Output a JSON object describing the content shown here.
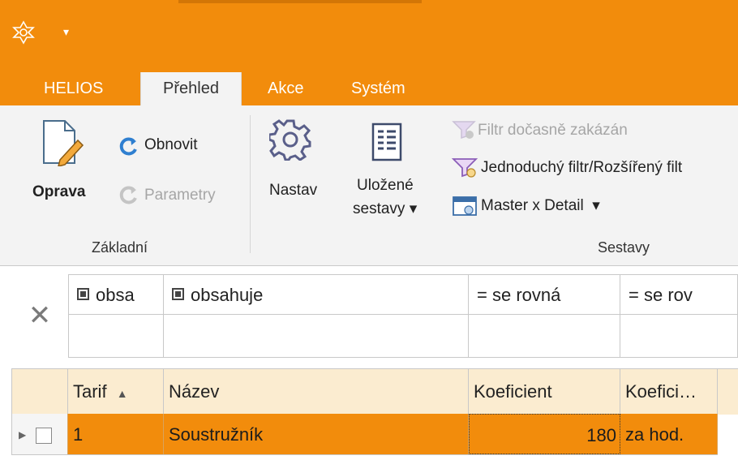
{
  "tabs": [
    "HELIOS",
    "Přehled",
    "Akce",
    "Systém"
  ],
  "ribbon": {
    "oprava": "Oprava",
    "obnovit": "Obnovit",
    "parametry": "Parametry",
    "zakladni": "Základní",
    "nastav": "Nastav",
    "ulozene_line1": "Uložené",
    "ulozene_line2": "sestavy",
    "filtr_zakazan": "Filtr dočasně zakázán",
    "jednoduchy_filtr": "Jednoduchý filtr/Rozšířený filt",
    "master_detail": "Master x Detail",
    "sestavy": "Sestavy"
  },
  "filter": {
    "col1": "obsa",
    "col2": "obsahuje",
    "col3": "se rovná",
    "col4": "se rov",
    "eq": "="
  },
  "grid": {
    "headers": [
      "Tarif",
      "Název",
      "Koeficient",
      "Koefici…"
    ],
    "sort_indicator": "▲",
    "rows": [
      {
        "tarif": "1",
        "nazev": "Soustružník",
        "koeficient": "180",
        "jednotka": "za hod."
      }
    ]
  },
  "colors": {
    "accent": "#f28c0c",
    "ribbon_bg": "#f3f3f3",
    "grid_header_bg": "#fbecd0"
  }
}
